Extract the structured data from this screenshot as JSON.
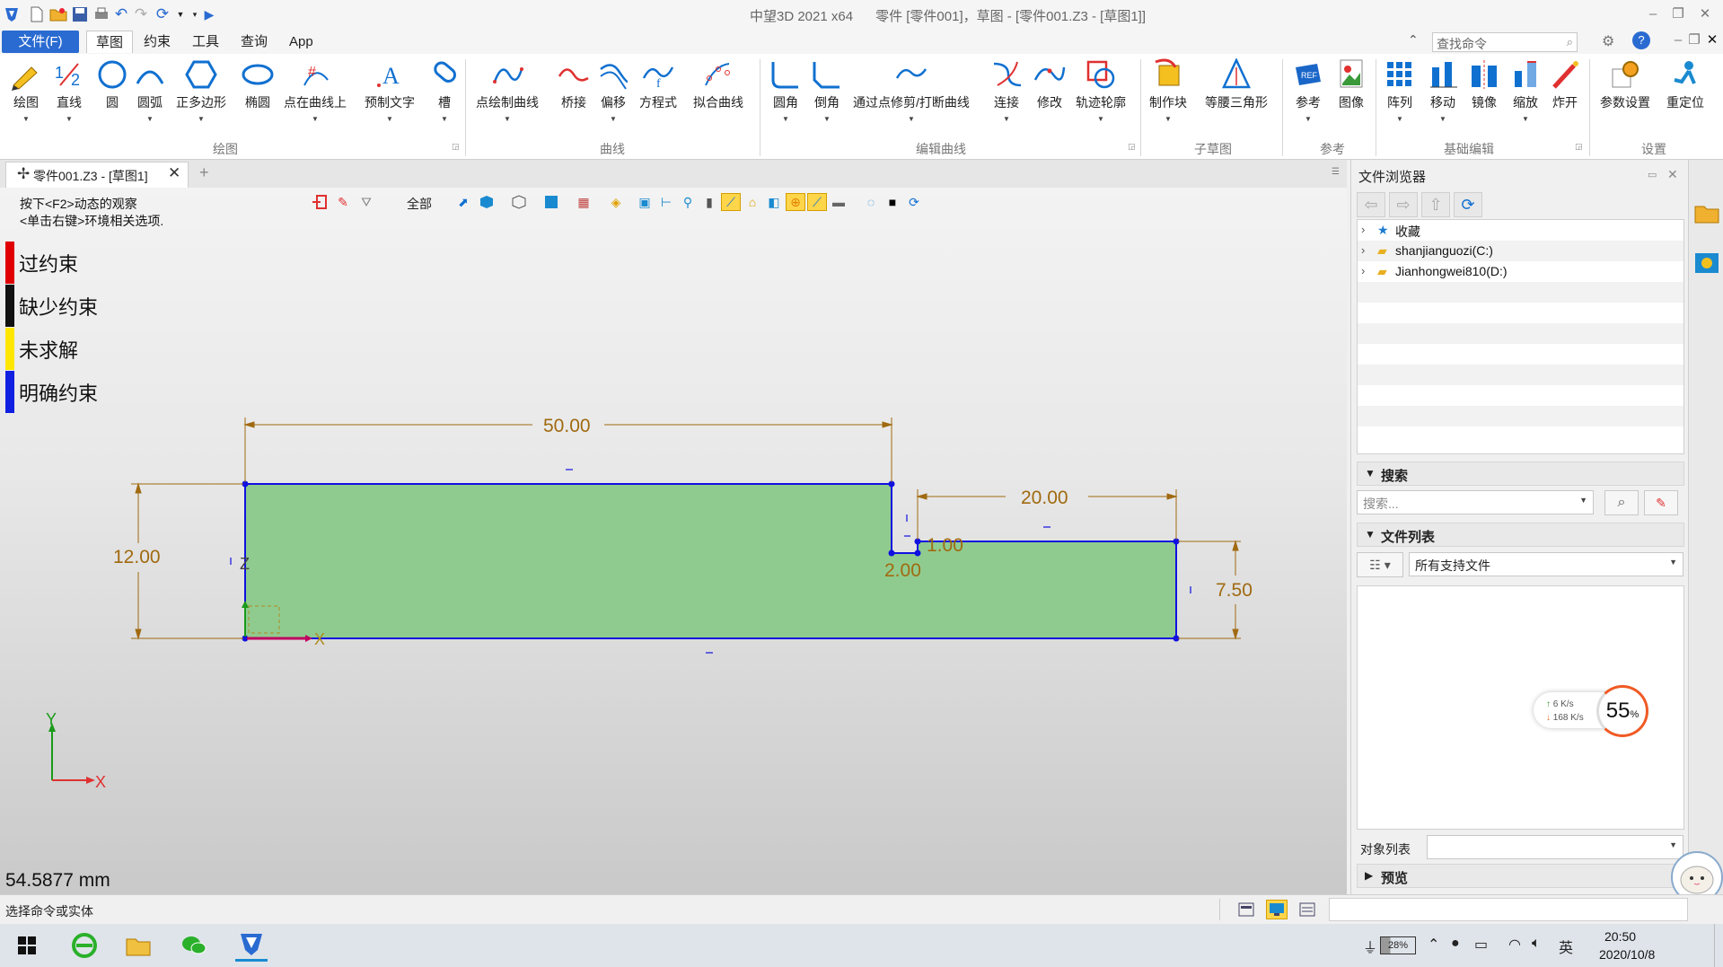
{
  "window": {
    "app_title": "中望3D 2021 x64",
    "doc_title": "零件 [零件001]，草图 - [零件001.Z3 - [草图1]]"
  },
  "menu_tabs": [
    "文件(F)",
    "草图",
    "约束",
    "工具",
    "查询",
    "App"
  ],
  "command_search": {
    "placeholder": "查找命令"
  },
  "ribbon": {
    "groups": [
      {
        "label": "绘图",
        "buttons": [
          "绘图",
          "直线",
          "圆",
          "圆弧",
          "正多边形",
          "椭圆",
          "点在曲线上",
          "预制文字",
          "槽"
        ]
      },
      {
        "label": "曲线",
        "buttons": [
          "点绘制曲线",
          "桥接",
          "偏移",
          "方程式",
          "拟合曲线"
        ]
      },
      {
        "label": "编辑曲线",
        "buttons": [
          "圆角",
          "倒角",
          "通过点修剪/打断曲线",
          "连接",
          "修改",
          "轨迹轮廓"
        ]
      },
      {
        "label": "子草图",
        "buttons": [
          "制作块",
          "等腰三角形"
        ]
      },
      {
        "label": "参考",
        "buttons": [
          "参考",
          "图像"
        ]
      },
      {
        "label": "基础编辑",
        "buttons": [
          "阵列",
          "移动",
          "镜像",
          "缩放",
          "炸开"
        ]
      },
      {
        "label": "设置",
        "buttons": [
          "参数设置",
          "重定位"
        ]
      }
    ]
  },
  "doc_tab": {
    "label": "零件001.Z3 - [草图1]"
  },
  "viewport": {
    "hint_line1": "按下<F2>动态的观察",
    "hint_line2": "<单击右键>环境相关选项.",
    "filter_label": "全部",
    "legend": [
      {
        "label": "过约束",
        "color": "#e00000"
      },
      {
        "label": "缺少约束",
        "color": "#111111"
      },
      {
        "label": "未求解",
        "color": "#ffe600"
      },
      {
        "label": "明确约束",
        "color": "#1020e0"
      }
    ],
    "dimensions": {
      "top_width": "50.00",
      "right_width": "20.00",
      "left_height": "12.00",
      "right_height": "7.50",
      "step_h": "1.00",
      "step_w": "2.00"
    },
    "axis_labels": {
      "x": "X",
      "y": "Y",
      "z": "Z"
    },
    "distance_readout": "54.5877 mm"
  },
  "file_browser": {
    "title": "文件浏览器",
    "tree": [
      "收藏",
      "shanjianguozi(C:)",
      "Jianhongwei810(D:)"
    ],
    "search_section": "搜索",
    "search_placeholder": "搜索...",
    "file_list_section": "文件列表",
    "file_filter": "所有支持文件",
    "object_list_label": "对象列表",
    "preview_section": "预览",
    "net_widget": {
      "up": "6",
      "down": "168",
      "unit": "K/s",
      "percent": "55"
    }
  },
  "status": {
    "text": "选择命令或实体"
  },
  "taskbar": {
    "battery": "28%",
    "time": "20:50",
    "date": "2020/10/8"
  },
  "colors": {
    "accent": "#2a6bd1",
    "sketch_fill": "#8fcb8f",
    "sketch_line": "#1010e0",
    "dimension": "#a06a10"
  }
}
